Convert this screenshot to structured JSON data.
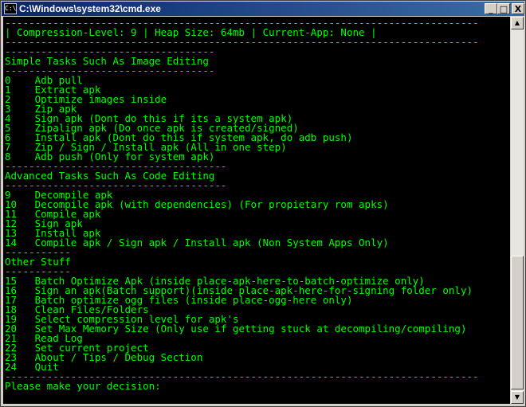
{
  "window": {
    "title": "C:\\Windows\\system32\\cmd.exe",
    "icon_label": "C:\\",
    "controls": {
      "minimize": "_",
      "maximize": "□",
      "close": "X"
    }
  },
  "console": {
    "text_color": "#00ff00",
    "background": "#000000",
    "lines": [
      "-------------------------------------------------------------------------------",
      "| Compression-Level: 9 | Heap Size: 64mb | Current-App: None |",
      "-------------------------------------------------------------------------------",
      "-----------------------------------",
      "Simple Tasks Such As Image Editing",
      "-----------------------------------",
      "0    Adb pull",
      "1    Extract apk",
      "2    Optimize images inside",
      "3    Zip apk",
      "4    Sign apk (Dont do this if its a system apk)",
      "5    Zipalign apk (Do once apk is created/signed)",
      "6    Install apk (Dont do this if system apk, do adb push)",
      "7    Zip / Sign / Install apk (All in one step)",
      "8    Adb push (Only for system apk)",
      "-------------------------------------",
      "Advanced Tasks Such As Code Editing",
      "-------------------------------------",
      "9    Decompile apk",
      "10   Decompile apk (with dependencies) (For propietary rom apks)",
      "11   Compile apk",
      "12   Sign apk",
      "13   Install apk",
      "14   Compile apk / Sign apk / Install apk (Non System Apps Only)",
      "-----------",
      "Other Stuff",
      "-----------",
      "15   Batch Optimize Apk (inside place-apk-here-to-batch-optimize only)",
      "16   Sign an apk(Batch support)(inside place-apk-here-for-signing folder only)",
      "17   Batch optimize ogg files (inside place-ogg-here only)",
      "18   Clean Files/Folders",
      "19   Select compression level for apk's",
      "20   Set Max Memory Size (Only use if getting stuck at decompiling/compiling)",
      "21   Read Log",
      "22   Set current project",
      "23   About / Tips / Debug Section",
      "24   Quit",
      "-------------------------------------------------------------------------------",
      "Please make your decision:"
    ]
  }
}
